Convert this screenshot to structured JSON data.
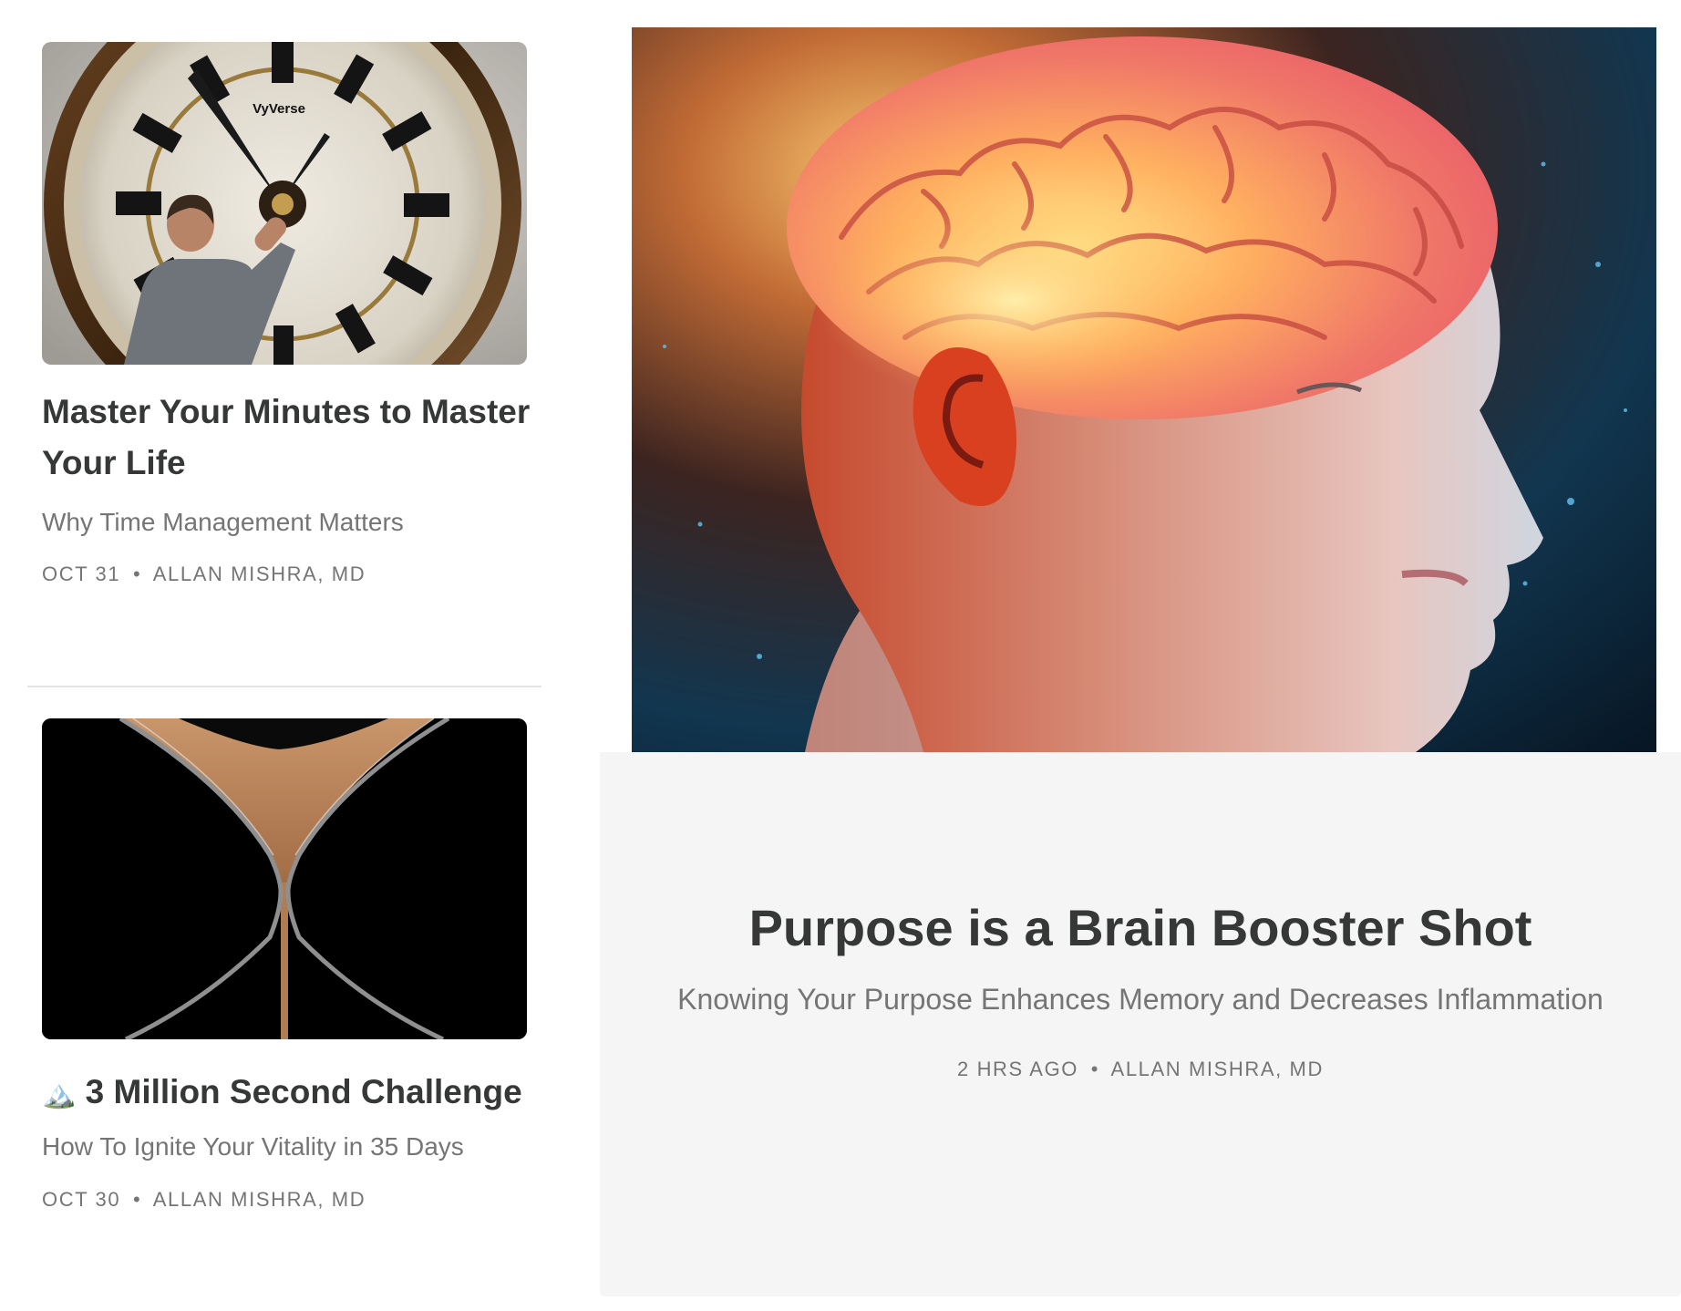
{
  "posts": [
    {
      "title": "Master Your Minutes to Master Your Life",
      "subtitle": "Why Time Management Matters",
      "date": "OCT 31",
      "author": "ALLAN MISHRA, MD",
      "image_icon": "clock-image",
      "image_caption": "VyVerse"
    },
    {
      "emoji": "🏔️",
      "title": "3 Million Second Challenge",
      "subtitle": "How To Ignite Your Vitality in 35 Days",
      "date": "OCT 30",
      "author": "ALLAN MISHRA, MD",
      "image_icon": "hourglass-image"
    }
  ],
  "featured": {
    "title": "Purpose is a Brain Booster Shot",
    "subtitle": "Knowing Your Purpose Enhances Memory and Decreases Inflammation",
    "date": "2 HRS AGO",
    "author": "ALLAN MISHRA, MD",
    "image_icon": "glowing-brain-image"
  },
  "meta_separator": "•",
  "colors": {
    "title": "#363737",
    "secondary_text": "#757575",
    "feature_panel": "#f5f5f5",
    "divider": "#e4e4e4"
  }
}
